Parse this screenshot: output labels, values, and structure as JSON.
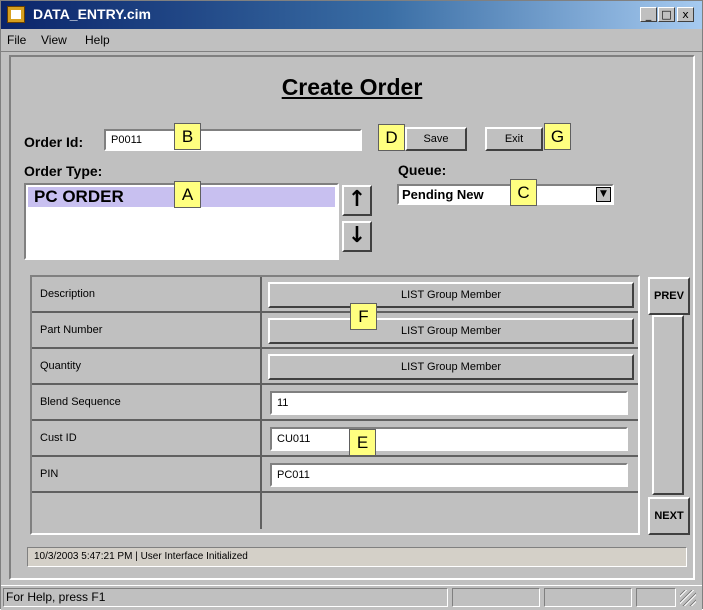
{
  "window": {
    "title": "DATA_ENTRY.cim",
    "controls": [
      "_",
      "□",
      "x"
    ]
  },
  "menu": [
    "File",
    "View",
    "Help"
  ],
  "form": {
    "title": "Create Order",
    "order_id_label": "Order Id:",
    "order_id_value": "P0011",
    "save_label": "Save",
    "exit_label": "Exit",
    "order_type_label": "Order Type:",
    "order_type_selected": "PC ORDER",
    "queue_label": "Queue:",
    "queue_value": "Pending New"
  },
  "grid": {
    "rows": [
      {
        "label": "Description",
        "kind": "button",
        "value": "LIST Group Member"
      },
      {
        "label": "Part Number",
        "kind": "button",
        "value": "LIST Group Member"
      },
      {
        "label": "Quantity",
        "kind": "button",
        "value": "LIST Group Member"
      },
      {
        "label": "Blend Sequence",
        "kind": "input",
        "value": "11"
      },
      {
        "label": "Cust ID",
        "kind": "input",
        "value": "CU011"
      },
      {
        "label": "PIN",
        "kind": "input",
        "value": "PC011"
      }
    ],
    "prev_label": "PREV",
    "next_label": "NEXT"
  },
  "callouts": {
    "a": "A",
    "b": "B",
    "c": "C",
    "d": "D",
    "e": "E",
    "f": "F",
    "g": "G"
  },
  "message_line": "10/3/2003 5:47:21 PM |  User Interface Initialized",
  "statusbar": {
    "help_text": "For Help, press F1"
  },
  "icons": {
    "app": "app-icon",
    "up": "up-arrow-icon",
    "down": "down-arrow-icon",
    "dropdown": "dropdown-arrow-icon"
  }
}
